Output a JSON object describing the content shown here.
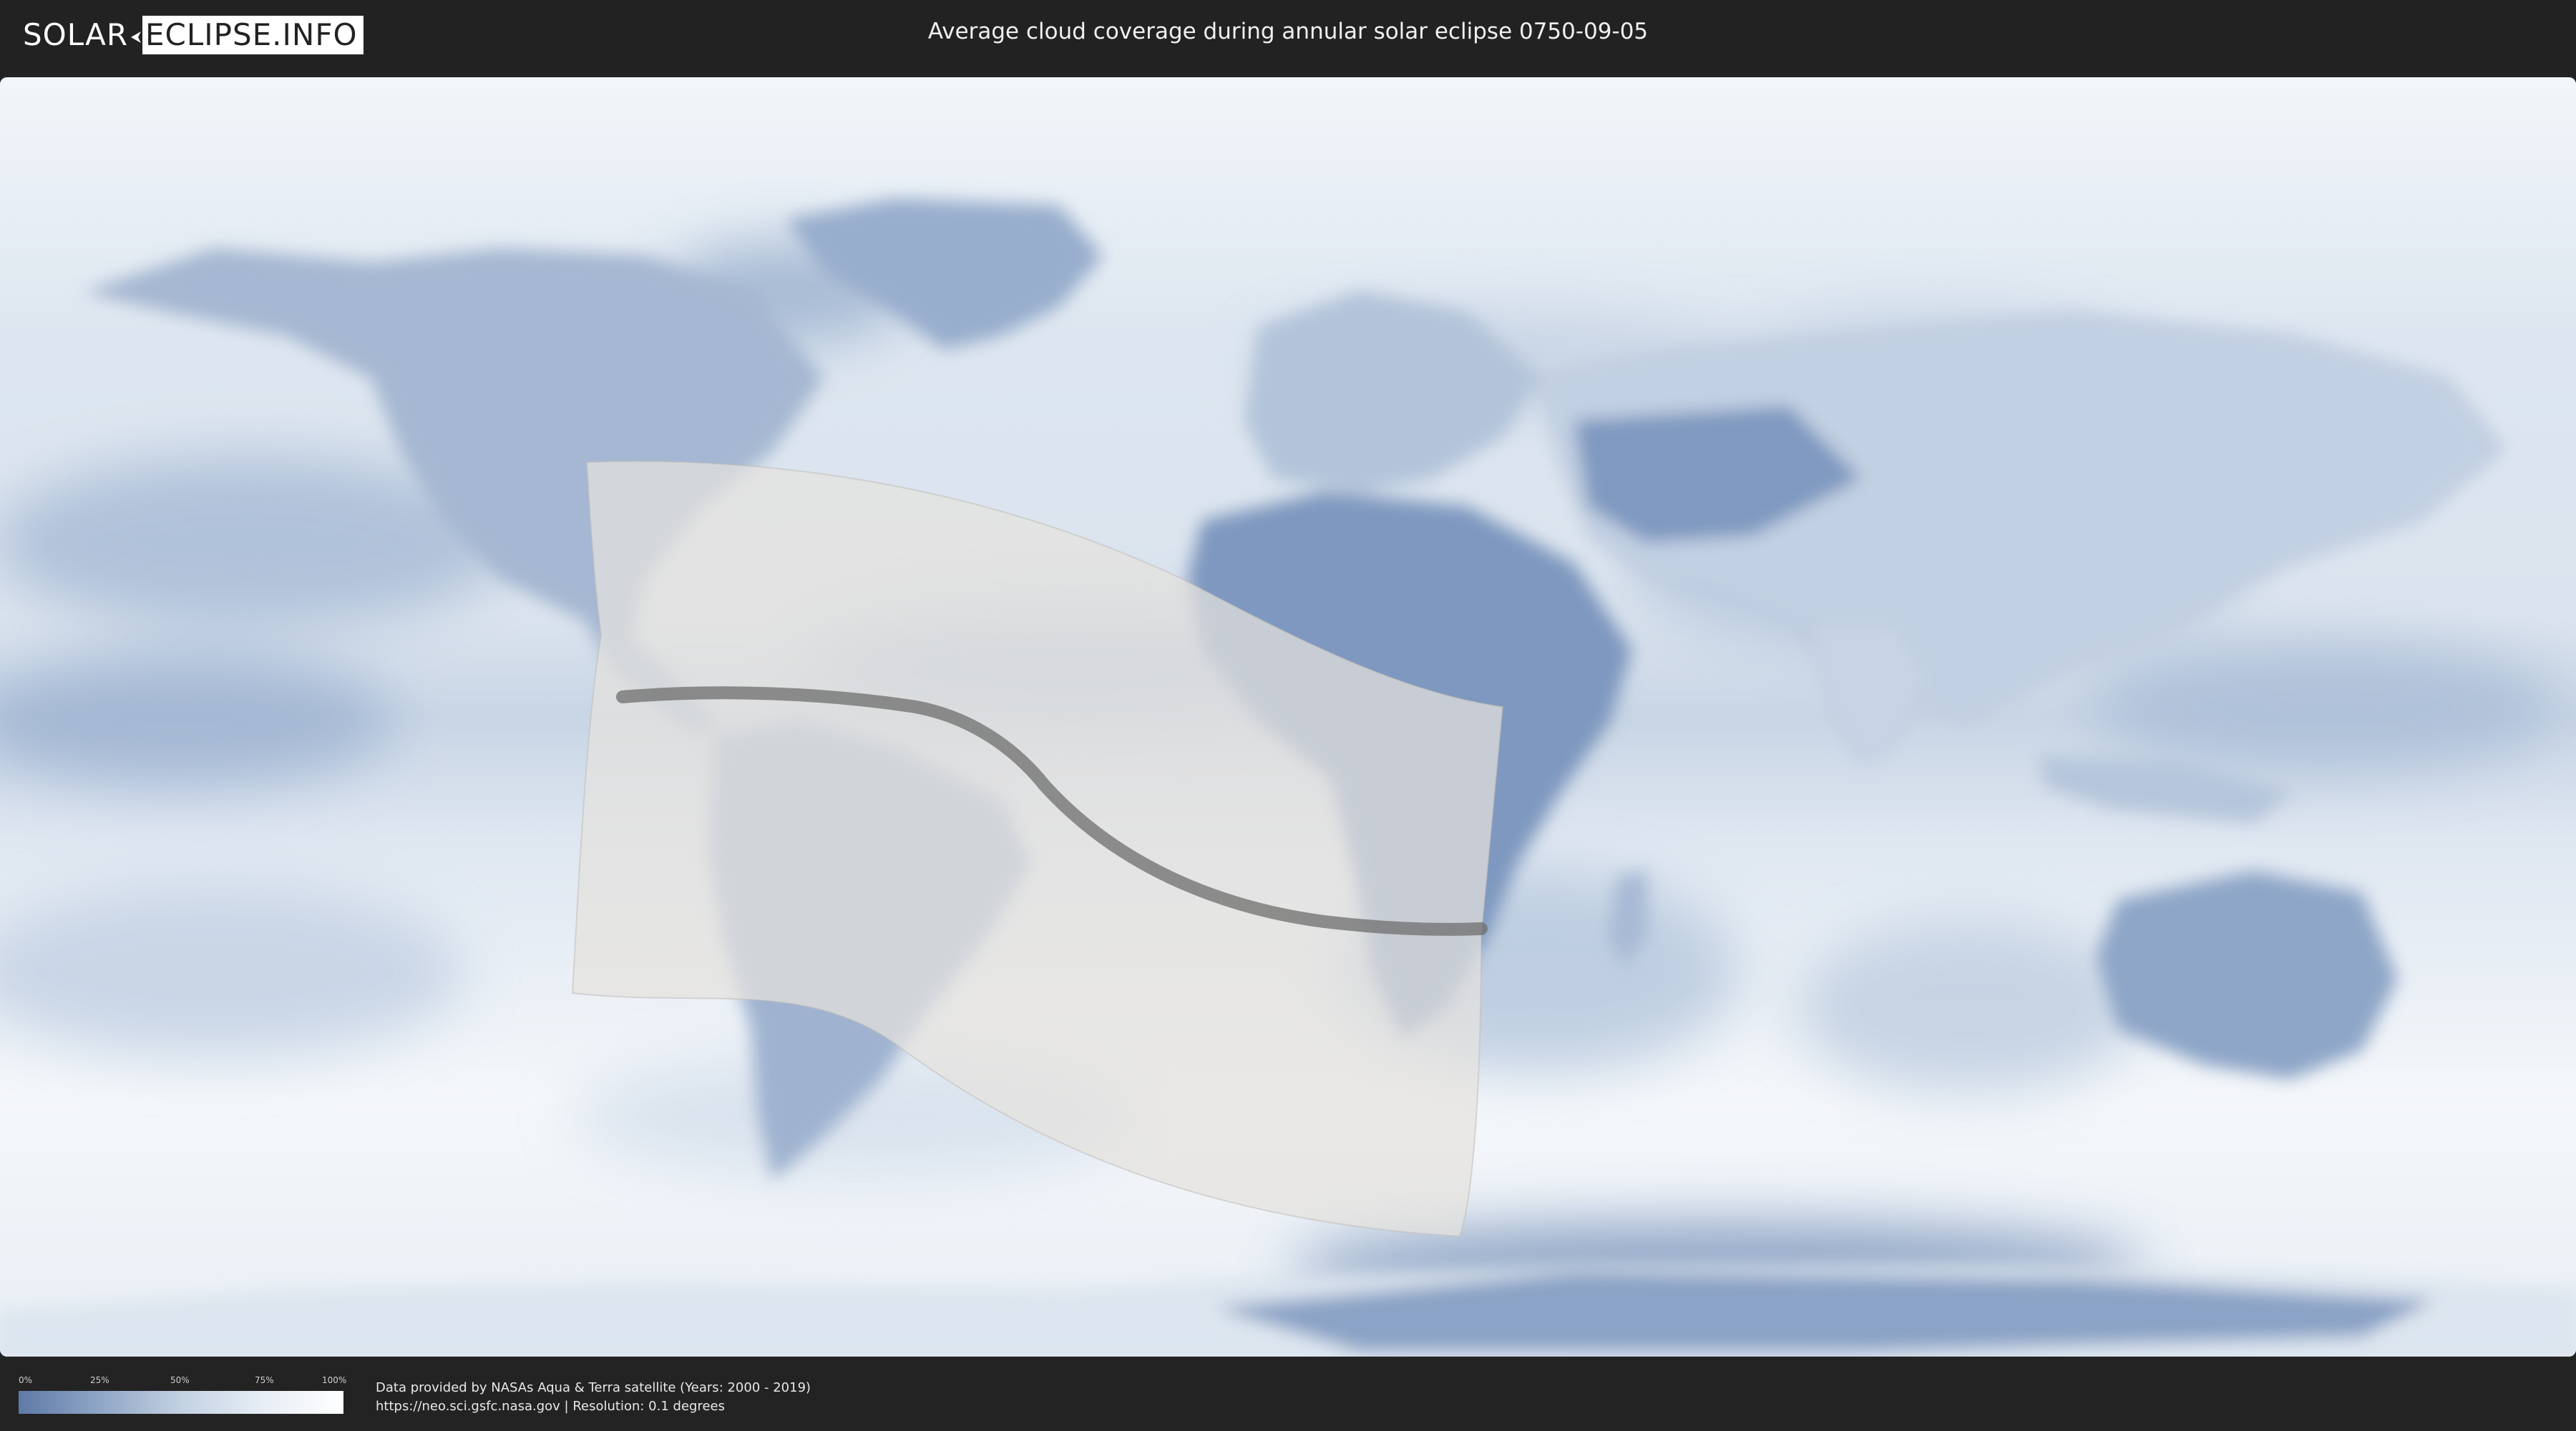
{
  "header": {
    "logo_left": "SOLAR",
    "logo_right": "ECLIPSE.INFO",
    "title": "Average cloud coverage during annular solar eclipse 0750-09-05"
  },
  "map": {
    "icon": "world-cloud-map",
    "colors": {
      "clear_sky": "#5e7aa6",
      "cloudy": "#ffffff",
      "eclipse_zone": "#e4e2de",
      "central_path": "#6e6e6e"
    }
  },
  "legend": {
    "ticks": [
      "0%",
      "25%",
      "50%",
      "75%",
      "100%"
    ]
  },
  "footer": {
    "credit_line1": "Data provided by NASAs Aqua & Terra satellite (Years: 2000 - 2019)",
    "credit_line2": "https://neo.sci.gsfc.nasa.gov | Resolution: 0.1 degrees"
  }
}
